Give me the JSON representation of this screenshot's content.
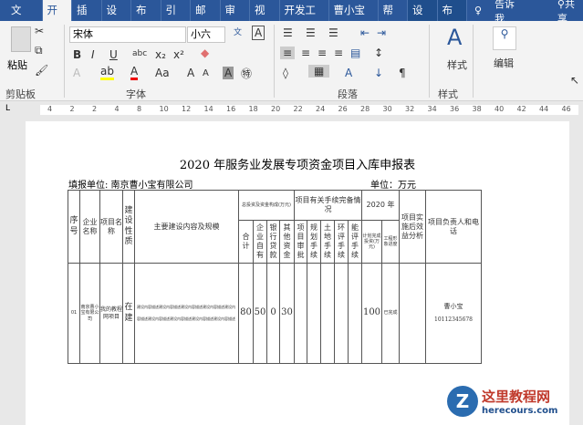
{
  "tabs": [
    "文件",
    "开始",
    "插入",
    "设计",
    "布局",
    "引用",
    "邮件",
    "审阅",
    "视图",
    "开发工具",
    "曹小宝的",
    "帮助",
    "设计",
    "布局"
  ],
  "tell_me": "告诉我",
  "share": "共享",
  "ribbon": {
    "paste": "粘贴",
    "clipboard": "剪贴板",
    "font_name": "宋体",
    "font_size": "小六",
    "font_group": "字体",
    "paragraph_group": "段落",
    "styles_btn": "样式",
    "styles_group": "样式",
    "edit_btn": "编辑",
    "bold": "B",
    "italic": "I",
    "underline": "U",
    "strike": "abc",
    "sub": "x₂",
    "sup": "x²",
    "case": "Aa",
    "grow": "A",
    "shrink": "A"
  },
  "ruler_ticks": [
    "4",
    "2",
    "2",
    "4",
    "8",
    "10",
    "12",
    "14",
    "16",
    "18",
    "20",
    "22",
    "24",
    "26",
    "28",
    "30",
    "32",
    "34",
    "36",
    "38",
    "40",
    "42",
    "44",
    "46"
  ],
  "doc": {
    "title": "2020 年服务业发展专项资金项目入库申报表",
    "org": "填报单位: 南京曹小宝有限公司",
    "unit": "单位：万元",
    "headers": {
      "seq": "序号",
      "company": "企业名称",
      "project": "项目名称",
      "nature": "建设性质",
      "content": "主要建设内容及规模",
      "invest": "总投资及资金构成(万元)",
      "procedures": "项目有关手续完备情况",
      "year": "2020 年",
      "benefit": "项目实施后效益分析",
      "contact": "项目负责人和电话",
      "total": "合计",
      "own": "企业自有",
      "bank": "银行贷款",
      "other": "其他资金",
      "approval": "项目审批",
      "planning": "规划手续",
      "land": "土地手续",
      "env": "环评手续",
      "energy": "能评手续",
      "plan_invest": "计划完成投资(万元)",
      "progress": "工程形象进度"
    },
    "row": {
      "seq": "01",
      "company": "南京曹小宝有限公司",
      "project": "我的教程网项目",
      "nature": "在建",
      "content": "建设内容描述建设内容描述建设内容描述建设内容描述建设内容描述建设内容描述建设内容描述建设内容描述建设内容描述",
      "total": "80",
      "own": "50",
      "bank": "0",
      "other": "30",
      "plan_invest": "100",
      "progress": "已完成",
      "person": "曹小宝",
      "phone": "10112345678"
    }
  },
  "watermark": {
    "name": "这里教程网",
    "url": "herecours.com"
  }
}
